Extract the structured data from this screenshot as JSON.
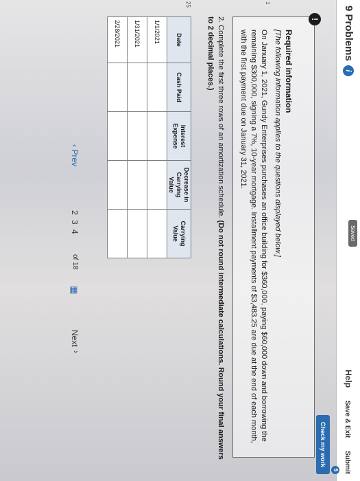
{
  "header": {
    "problems_label": "9 Problems",
    "info_icon": "i",
    "saved_label": "Saved",
    "help_label": "Help",
    "save_exit_label": "Save & Exit",
    "submit_label": "Submit",
    "check_work_label": "Check my work",
    "badge_count": "5"
  },
  "side_numbers": [
    "1",
    "25"
  ],
  "info": {
    "alert_icon": "!",
    "title": "Required information",
    "note": "[The following information applies to the questions displayed below.]",
    "body": "On January 1, 2021, Gundy Enterprises purchases an office building for $360,000, paying $60,000 down and borrowing the remaining $300,000, signing a 7%, 10-year mortgage. Installment payments of $3,483.25 are due at the end of each month, with the first payment due on January 31, 2021."
  },
  "question": {
    "text": "2. Complete the first three rows of an amortization schedule.",
    "instruction": "(Do not round intermediate calculations. Round your final answers to 2 decimal places.)"
  },
  "table": {
    "headers": [
      "Date",
      "Cash Paid",
      "Interest Expense",
      "Decrease in Carrying Value",
      "Carrying Value"
    ],
    "rows": [
      {
        "date": "1/1/2021"
      },
      {
        "date": "1/31/2021"
      },
      {
        "date": "2/28/2021"
      }
    ]
  },
  "pager": {
    "prev_label": "Prev",
    "pages": "2  3  4",
    "of_label": "of 18",
    "next_label": "Next"
  }
}
